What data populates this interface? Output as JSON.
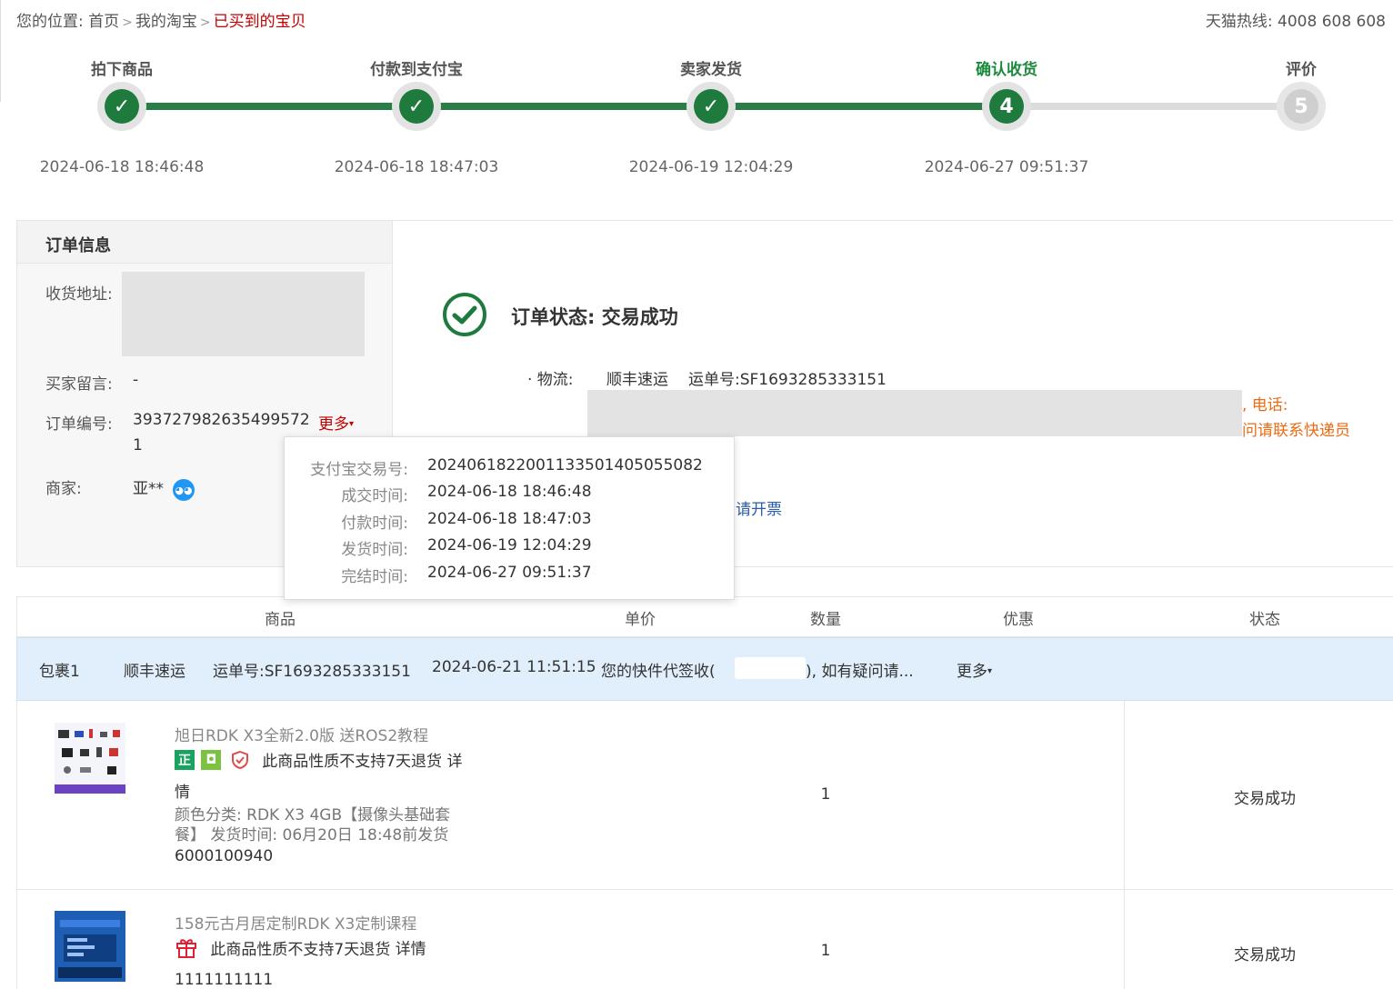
{
  "breadcrumb": {
    "prefix": "您的位置:",
    "items": [
      "首页",
      "我的淘宝",
      "已买到的宝贝"
    ]
  },
  "hotline": "天猫热线: 4008 608 608",
  "steps": [
    {
      "label": "拍下商品",
      "time": "2024-06-18 18:46:48",
      "state": "done",
      "marker": "✓"
    },
    {
      "label": "付款到支付宝",
      "time": "2024-06-18 18:47:03",
      "state": "done",
      "marker": "✓"
    },
    {
      "label": "卖家发货",
      "time": "2024-06-19 12:04:29",
      "state": "done",
      "marker": "✓"
    },
    {
      "label": "确认收货",
      "time": "2024-06-27 09:51:37",
      "state": "current",
      "marker": "4"
    },
    {
      "label": "评价",
      "time": "",
      "state": "todo",
      "marker": "5"
    }
  ],
  "order_info": {
    "title": "订单信息",
    "address_label": "收货地址:",
    "buyer_msg_label": "买家留言:",
    "buyer_msg_value": "-",
    "order_no_label": "订单编号:",
    "order_no_value": "393727982635499572",
    "order_no_tail": "1",
    "more_label": "更多",
    "merchant_label": "商家:",
    "merchant_value": "亚**"
  },
  "status": {
    "text": "订单状态: 交易成功",
    "logistics_label": "· 物流:",
    "carrier": "顺丰速运",
    "tracking": "运单号:SF1693285333151",
    "phone_suffix": ", 电话:",
    "contact_suffix": "问请联系快递员",
    "invoice_link": "请开票"
  },
  "popup": [
    {
      "label": "支付宝交易号:",
      "value": "2024061822001133501405055082"
    },
    {
      "label": "成交时间:",
      "value": "2024-06-18 18:46:48"
    },
    {
      "label": "付款时间:",
      "value": "2024-06-18 18:47:03"
    },
    {
      "label": "发货时间:",
      "value": "2024-06-19 12:04:29"
    },
    {
      "label": "完结时间:",
      "value": "2024-06-27 09:51:37"
    }
  ],
  "table": {
    "headers": [
      "商品",
      "单价",
      "数量",
      "优惠",
      "状态"
    ],
    "package": {
      "name": "包裹1",
      "carrier": "顺丰速运",
      "tracking": "运单号:SF1693285333151",
      "time": "2024-06-21 11:51:15",
      "message_start": "您的快件代签收(",
      "message_end": "), 如有疑问请...",
      "more": "更多"
    },
    "rows": [
      {
        "title": "旭日RDK X3全新2.0版 送ROS2教程",
        "notice": "此商品性质不支持7天退货",
        "detail_link_a": "详",
        "detail_link_b": "情",
        "spec_line1": "颜色分类: RDK X3 4GB【摄像头基础套",
        "spec_line2": "餐】 发货时间: 06月20日 18:48前发货",
        "code": "6000100940",
        "qty": "1",
        "state": "交易成功"
      },
      {
        "title": "158元古月居定制RDK X3定制课程",
        "notice": "此商品性质不支持7天退货",
        "detail_link": "详情",
        "code": "1111111111",
        "qty": "1",
        "state": "交易成功"
      }
    ]
  },
  "colors": {
    "success": "#1f7a3e",
    "accent_red": "#c40000",
    "orange": "#ec6b13",
    "link_blue": "#2a5caa",
    "package_bg": "#e1eefb"
  },
  "icons": [
    "check-icon",
    "success-circle-icon",
    "wangwang-icon",
    "chevron-down-icon",
    "genuine-badge-icon",
    "tmall-badge-icon",
    "shield-icon",
    "gift-icon"
  ]
}
